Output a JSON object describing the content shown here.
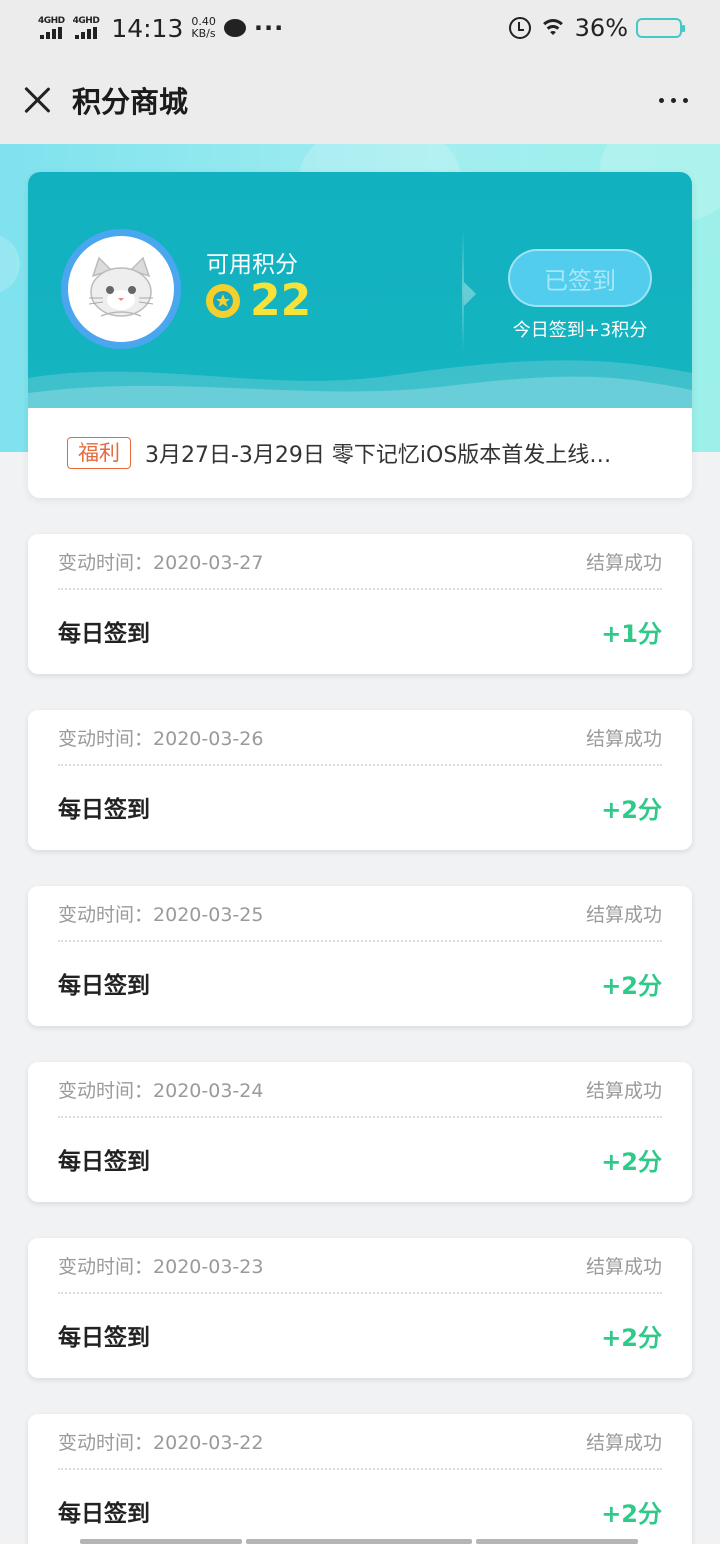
{
  "status_bar": {
    "network1": "4GHD",
    "network2": "4GHD",
    "time": "14:13",
    "speed_value": "0.40",
    "speed_unit": "KB/s",
    "more": "···",
    "battery": "36%",
    "battery_level": 0.36
  },
  "header": {
    "title": "积分商城"
  },
  "points_card": {
    "label": "可用积分",
    "value": "22",
    "signed_label": "已签到",
    "sign_tip": "今日签到+3积分"
  },
  "notice": {
    "badge": "福利",
    "text": "3月27日-3月29日 零下记忆iOS版本首发上线…"
  },
  "records": [
    {
      "time_label": "变动时间：",
      "date": "2020-03-27",
      "status": "结算成功",
      "title": "每日签到",
      "points": "+1分"
    },
    {
      "time_label": "变动时间：",
      "date": "2020-03-26",
      "status": "结算成功",
      "title": "每日签到",
      "points": "+2分"
    },
    {
      "time_label": "变动时间：",
      "date": "2020-03-25",
      "status": "结算成功",
      "title": "每日签到",
      "points": "+2分"
    },
    {
      "time_label": "变动时间：",
      "date": "2020-03-24",
      "status": "结算成功",
      "title": "每日签到",
      "points": "+2分"
    },
    {
      "time_label": "变动时间：",
      "date": "2020-03-23",
      "status": "结算成功",
      "title": "每日签到",
      "points": "+2分"
    },
    {
      "time_label": "变动时间：",
      "date": "2020-03-22",
      "status": "结算成功",
      "title": "每日签到",
      "points": "+2分"
    }
  ],
  "colors": {
    "card_teal": "#12b1bf",
    "points_yellow": "#f7e23a",
    "plus_green": "#2fc98a",
    "badge_orange": "#e66a3f"
  }
}
